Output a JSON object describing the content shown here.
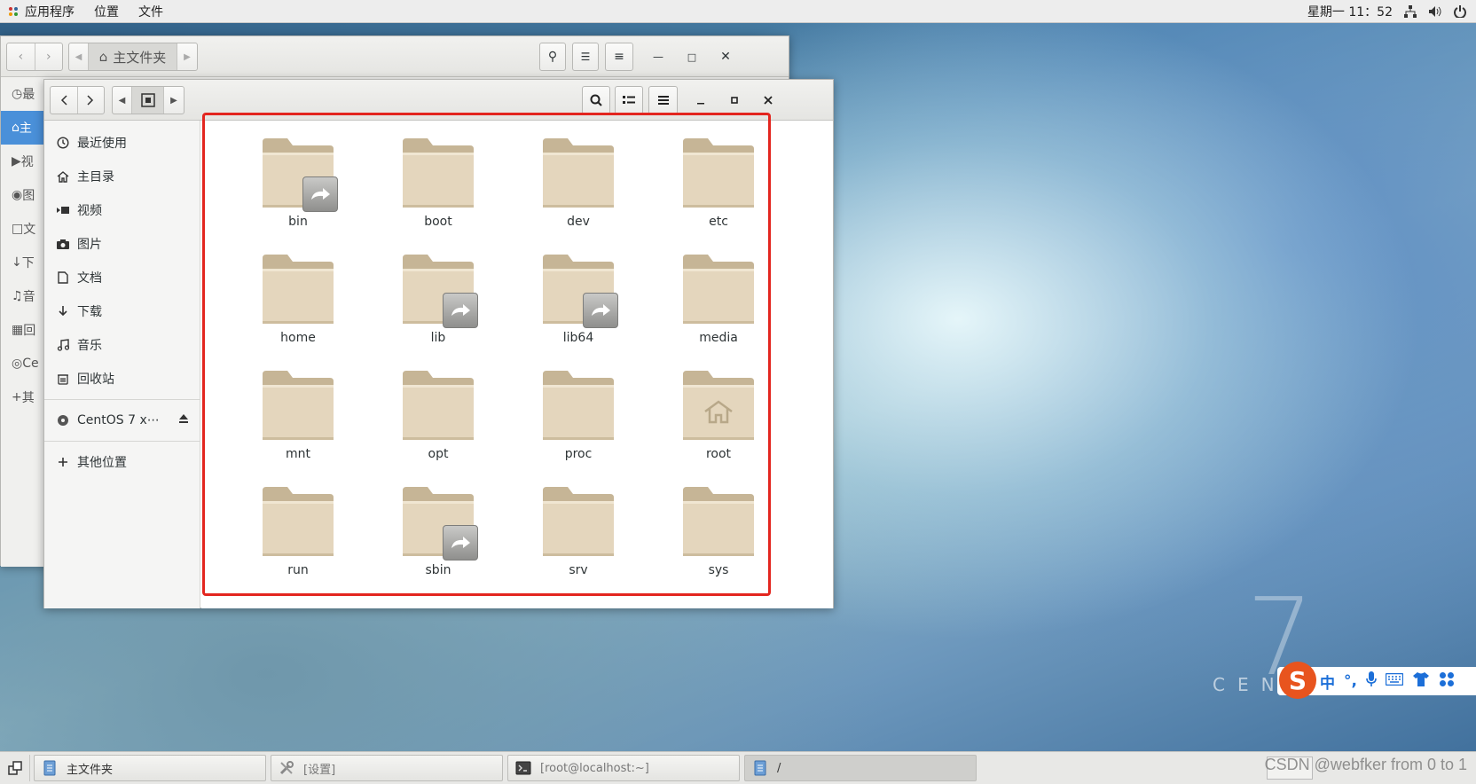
{
  "topbar": {
    "menus": [
      "应用程序",
      "位置",
      "文件"
    ],
    "clock": "星期一 11：52"
  },
  "back_window": {
    "path_label": "主文件夹",
    "sidebar": [
      "最",
      "主",
      "视",
      "图",
      "文",
      "下",
      "音",
      "回",
      "Ce",
      "其"
    ]
  },
  "front_window": {
    "sidebar": {
      "items": [
        {
          "label": "最近使用",
          "icon": "clock-icon"
        },
        {
          "label": "主目录",
          "icon": "home-icon"
        },
        {
          "label": "视频",
          "icon": "video-icon"
        },
        {
          "label": "图片",
          "icon": "camera-icon"
        },
        {
          "label": "文档",
          "icon": "document-icon"
        },
        {
          "label": "下载",
          "icon": "download-icon"
        },
        {
          "label": "音乐",
          "icon": "music-icon"
        },
        {
          "label": "回收站",
          "icon": "trash-icon"
        }
      ],
      "device": {
        "label": "CentOS 7 x⋯",
        "icon": "disc-icon"
      },
      "other": {
        "label": "其他位置",
        "icon": "plus-icon"
      }
    },
    "folders": [
      {
        "name": "bin",
        "link": true,
        "home": false
      },
      {
        "name": "boot",
        "link": false,
        "home": false
      },
      {
        "name": "dev",
        "link": false,
        "home": false
      },
      {
        "name": "etc",
        "link": false,
        "home": false
      },
      {
        "name": "home",
        "link": false,
        "home": false
      },
      {
        "name": "lib",
        "link": true,
        "home": false
      },
      {
        "name": "lib64",
        "link": true,
        "home": false
      },
      {
        "name": "media",
        "link": false,
        "home": false
      },
      {
        "name": "mnt",
        "link": false,
        "home": false
      },
      {
        "name": "opt",
        "link": false,
        "home": false
      },
      {
        "name": "proc",
        "link": false,
        "home": false
      },
      {
        "name": "root",
        "link": false,
        "home": true
      },
      {
        "name": "run",
        "link": false,
        "home": false
      },
      {
        "name": "sbin",
        "link": true,
        "home": false
      },
      {
        "name": "srv",
        "link": false,
        "home": false
      },
      {
        "name": "sys",
        "link": false,
        "home": false
      }
    ]
  },
  "desktop": {
    "logo_text": "CENTOS",
    "logo_number": "7"
  },
  "ime": {
    "items": [
      "中",
      "°,",
      "mic-icon",
      "keyboard-icon",
      "shirt-icon",
      "grid-icon"
    ],
    "chinese": "中",
    "punct": "°,",
    "logo": "S"
  },
  "taskbar": {
    "items": [
      {
        "label": "主文件夹",
        "icon": "file-manager-icon",
        "state": "normal"
      },
      {
        "label": "[设置]",
        "icon": "settings-icon",
        "state": "dim"
      },
      {
        "label": "[root@localhost:~]",
        "icon": "terminal-icon",
        "state": "dim"
      },
      {
        "label": "/",
        "icon": "file-manager-icon",
        "state": "active"
      }
    ]
  },
  "watermark": "CSDN @webfker from 0 to 1",
  "colors": {
    "highlight": "#e3261f",
    "selection": "#4a90d9",
    "folder": "#e2d3b9"
  }
}
